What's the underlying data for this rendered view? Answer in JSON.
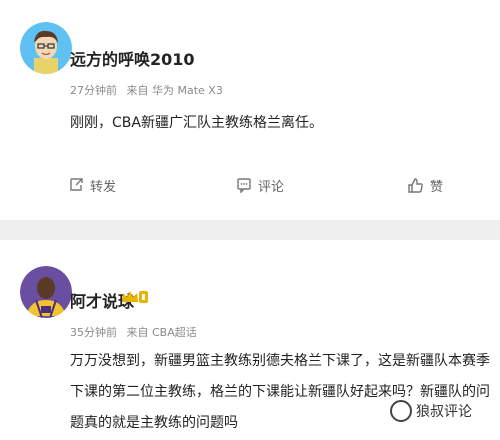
{
  "posts": [
    {
      "username": "远方的呼唤2010",
      "time": "27分钟前",
      "source": "来自 华为 Mate X3",
      "text": "刚刚，CBA新疆广汇队主教练格兰离任。",
      "avatar": "cartoon-avatar-icon",
      "actions": {
        "repost": "转发",
        "comment": "评论",
        "like": "赞"
      }
    },
    {
      "username": "阿才说球",
      "time": "35分钟前",
      "source": "来自 CBA超话",
      "text": "万万没想到，新疆男篮主教练别德夫格兰下课了，这是新疆队本赛季下课的第二位主教练，格兰的下课能让新疆队好起来吗？新疆队的问题真的就是主教练的问题吗",
      "avatar": "basketball-player-avatar-icon",
      "badge": "verified-badge-icon"
    }
  ],
  "watermark": "狼叔评论",
  "colors": {
    "background": "#efefef",
    "card": "#ffffff",
    "meta_text": "#8a8a8a",
    "badge_gold": "#e8b400"
  }
}
